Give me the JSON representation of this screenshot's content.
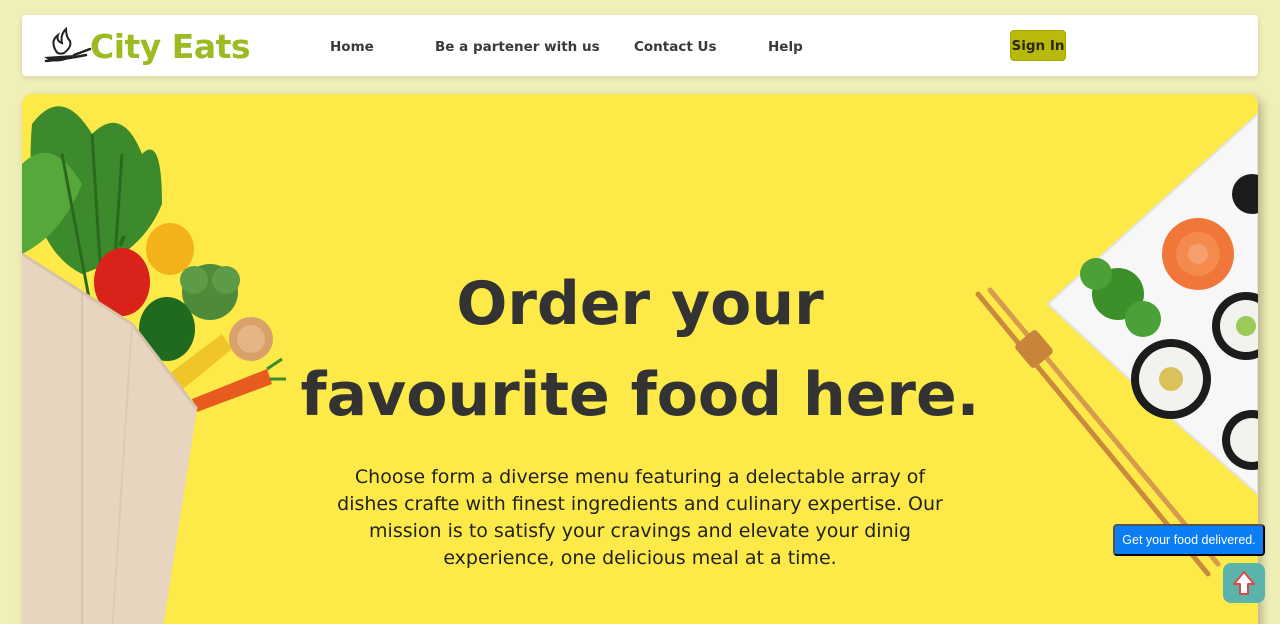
{
  "brand": {
    "name": "City Eats",
    "color": "#9cbb22",
    "icon": "chef-pan-icon"
  },
  "nav": {
    "links": [
      {
        "label": "Home"
      },
      {
        "label": "Be a partener with us"
      },
      {
        "label": "Contact Us"
      },
      {
        "label": "Help"
      }
    ],
    "signin_label": "Sign In"
  },
  "hero": {
    "title_line1": "Order your",
    "title_line2": "favourite food here.",
    "description": "Choose form a diverse menu featuring a delectable array of dishes crafte with finest ingredients and culinary expertise. Our mission is to satisfy your cravings and elevate your dinig experience, one delicious meal at a time.",
    "background": "#fdea48",
    "left_image": "grocery-bag-vegetables",
    "right_image": "sushi-plate-chopsticks"
  },
  "floating": {
    "delivered_label": "Get your food delivered.",
    "scroll_icon": "arrow-up-icon"
  }
}
